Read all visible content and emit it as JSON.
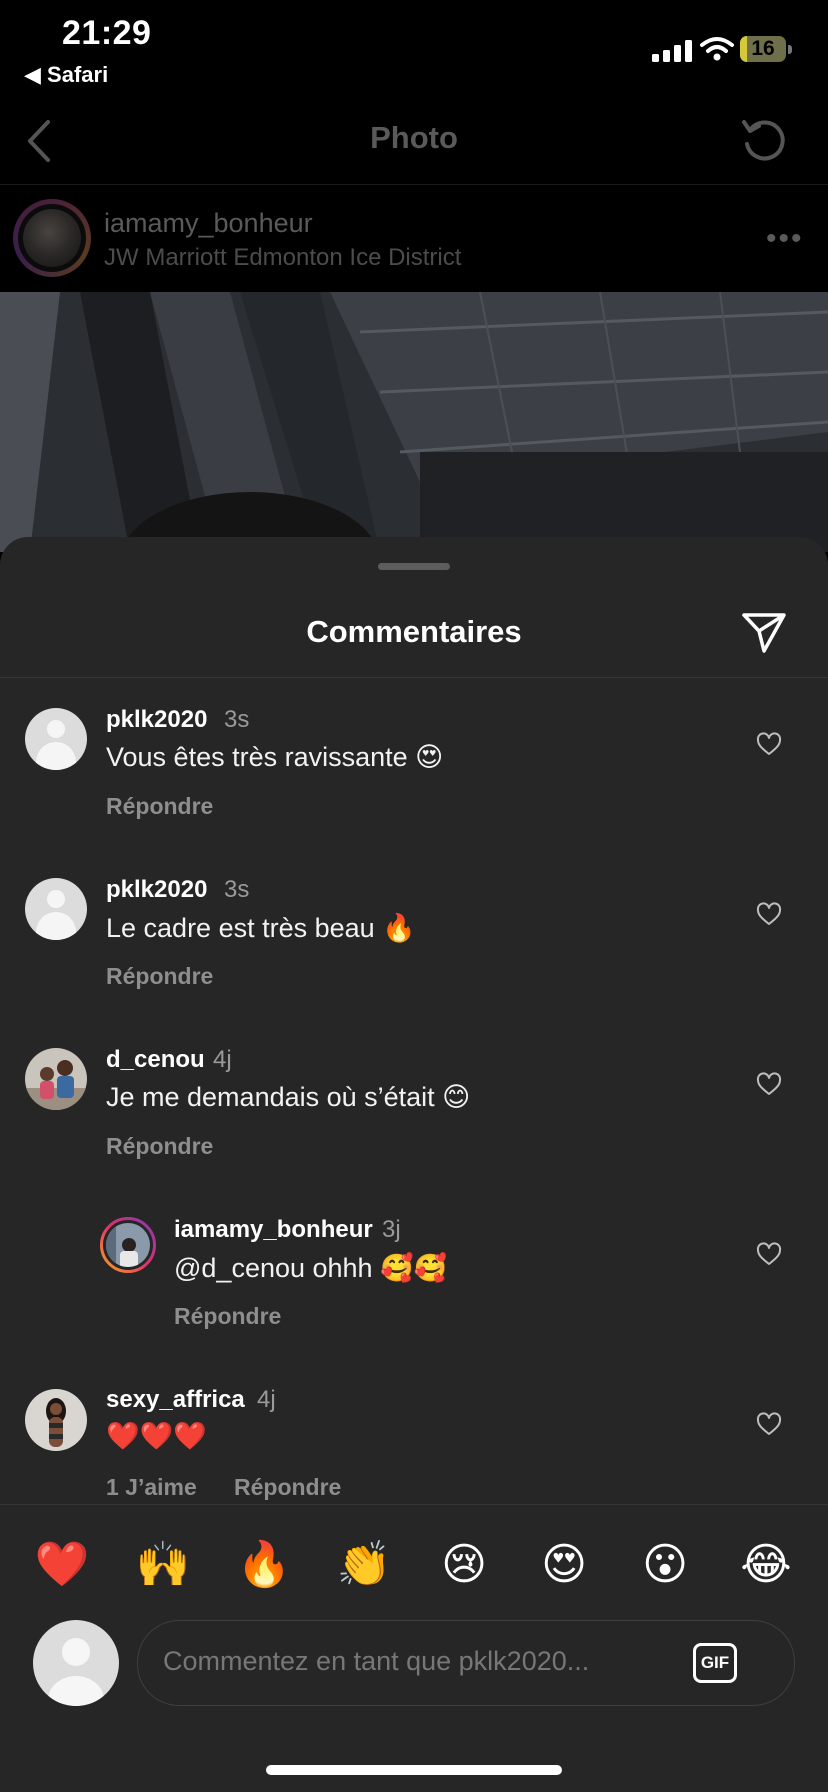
{
  "status_bar": {
    "time": "21:29",
    "back_app": "◀ Safari",
    "battery": "16",
    "battery_level": 0.16
  },
  "nav": {
    "title": "Photo"
  },
  "post": {
    "username": "iamamy_bonheur",
    "location": "JW Marriott Edmonton Ice District",
    "more": "•••"
  },
  "sheet": {
    "title": "Commentaires"
  },
  "comments": [
    {
      "user": "pklk2020",
      "time": "3s",
      "text": "Vous êtes très ravissante 😍",
      "reply": "Répondre"
    },
    {
      "user": "pklk2020",
      "time": "3s",
      "text": "Le cadre est très beau 🔥",
      "reply": "Répondre"
    },
    {
      "user": "d_cenou",
      "time": "4j",
      "text": "Je me demandais où s’était 😊",
      "reply": "Répondre"
    },
    {
      "user": "iamamy_bonheur",
      "time": "3j",
      "text": "@d_cenou ohhh 🥰🥰",
      "reply": "Répondre"
    },
    {
      "user": "sexy_affrica",
      "time": "4j",
      "text": "❤️❤️❤️",
      "likes": "1 J’aime",
      "reply": "Répondre"
    }
  ],
  "emoji_bar": [
    "❤️",
    "🙌",
    "🔥",
    "👏",
    "😢",
    "😍",
    "😮",
    "😂"
  ],
  "input": {
    "placeholder": "Commentez en tant que pklk2020...",
    "gif": "GIF"
  }
}
